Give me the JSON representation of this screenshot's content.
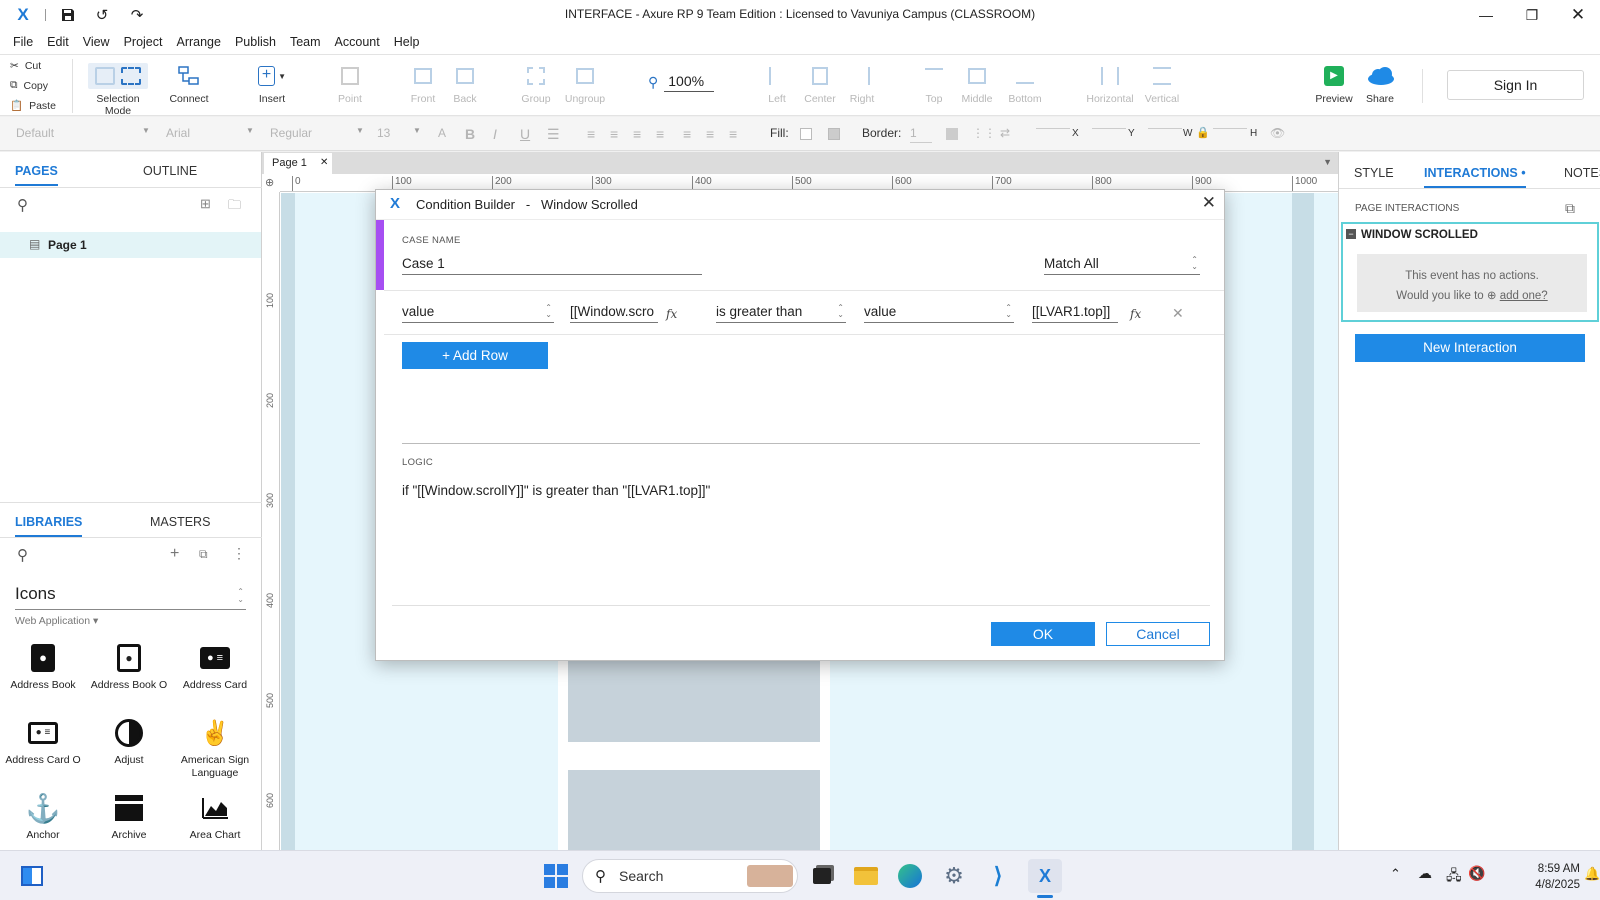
{
  "window": {
    "title": "INTERFACE - Axure RP 9 Team Edition : Licensed to Vavuniya Campus (CLASSROOM)"
  },
  "menu": [
    "File",
    "Edit",
    "View",
    "Project",
    "Arrange",
    "Publish",
    "Team",
    "Account",
    "Help"
  ],
  "clipboard": {
    "cut": "Cut",
    "copy": "Copy",
    "paste": "Paste"
  },
  "toolbar": {
    "selection_mode": "Selection Mode",
    "connect": "Connect",
    "insert": "Insert",
    "point": "Point",
    "front": "Front",
    "back": "Back",
    "group": "Group",
    "ungroup": "Ungroup",
    "zoom": "100%",
    "left": "Left",
    "center": "Center",
    "right": "Right",
    "top": "Top",
    "middle": "Middle",
    "bottom": "Bottom",
    "horizontal": "Horizontal",
    "vertical": "Vertical",
    "preview": "Preview",
    "share": "Share",
    "sign_in": "Sign In"
  },
  "stylebar": {
    "style": "Default",
    "font": "Arial",
    "weight": "Regular",
    "size": "13",
    "fill_label": "Fill:",
    "border_label": "Border:",
    "border_value": "1",
    "x": "X",
    "y": "Y",
    "w": "W",
    "h": "H"
  },
  "pages_panel": {
    "tab_pages": "PAGES",
    "tab_outline": "OUTLINE",
    "pages": [
      "Page 1"
    ]
  },
  "libraries_panel": {
    "tab_libraries": "LIBRARIES",
    "tab_masters": "MASTERS",
    "library": "Icons",
    "category": "Web Application ▾",
    "items": [
      "Address Book",
      "Address Book O",
      "Address Card",
      "Address Card O",
      "Adjust",
      "American Sign Language",
      "Anchor",
      "Archive",
      "Area Chart"
    ]
  },
  "canvas": {
    "page_tab": "Page 1",
    "ruler_h": [
      "0",
      "100",
      "200",
      "300",
      "400",
      "500",
      "600",
      "700",
      "800",
      "900",
      "1000"
    ],
    "ruler_v": [
      "100",
      "200",
      "300",
      "400",
      "500",
      "600"
    ]
  },
  "right_panel": {
    "tab_style": "STYLE",
    "tab_interactions": "INTERACTIONS •",
    "tab_notes": "NOTES",
    "section": "PAGE INTERACTIONS",
    "event": "WINDOW SCROLLED",
    "empty_line1": "This event has no actions.",
    "empty_line2": "Would you like to",
    "add_one": "add one?",
    "new_interaction": "New Interaction"
  },
  "dialog": {
    "title": "Condition Builder   -   Window Scrolled",
    "case_name_label": "CASE NAME",
    "case_name": "Case 1",
    "match": "Match All",
    "condition": {
      "left_type": "value",
      "left_value": "[[Window.scro",
      "operator": "is greater than",
      "right_type": "value",
      "right_value": "[[LVAR1.top]]"
    },
    "add_row": "+ Add Row",
    "logic_label": "LOGIC",
    "logic": "if \"[[Window.scrollY]]\" is greater than \"[[LVAR1.top]]\"",
    "ok": "OK",
    "cancel": "Cancel"
  },
  "taskbar": {
    "search": "Search",
    "time": "8:59 AM",
    "date": "4/8/2025"
  },
  "colors": {
    "accent": "#1f8ae6",
    "purple": "#a64ff2",
    "canvas_bg": "#e6f6fc",
    "highlight": "#5fd0d8"
  }
}
